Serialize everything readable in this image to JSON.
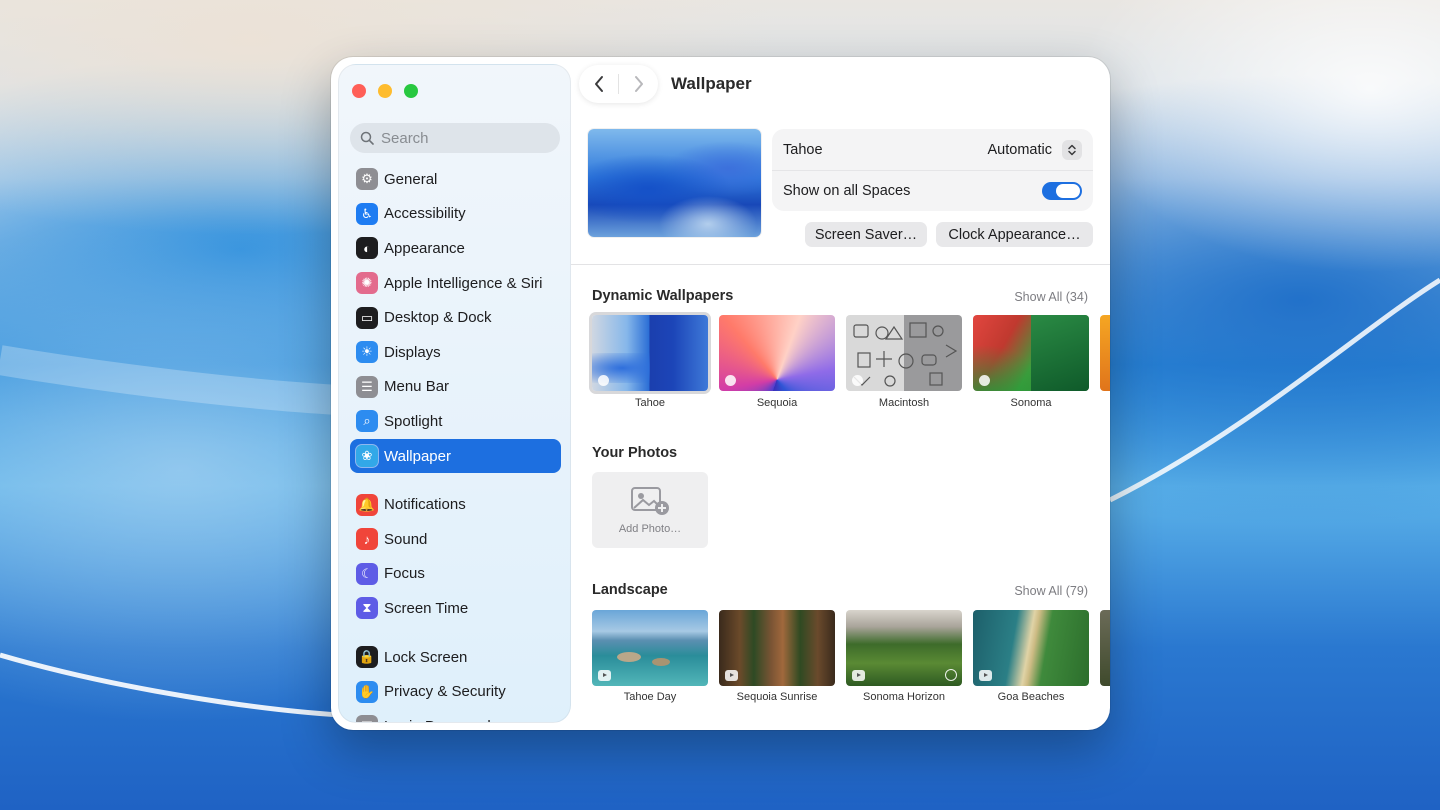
{
  "window": {
    "title": "Wallpaper",
    "search_placeholder": "Search"
  },
  "sidebar": {
    "groups": [
      [
        {
          "label": "General",
          "icon": "gear-icon",
          "color": "#8e8e93"
        },
        {
          "label": "Accessibility",
          "icon": "accessibility-icon",
          "color": "#1e7cf2"
        },
        {
          "label": "Appearance",
          "icon": "appearance-icon",
          "color": "#1d1d1f"
        },
        {
          "label": "Apple Intelligence & Siri",
          "icon": "siri-icon",
          "color": "#e36b8d"
        },
        {
          "label": "Desktop & Dock",
          "icon": "dock-icon",
          "color": "#1d1d1f"
        },
        {
          "label": "Displays",
          "icon": "sun-icon",
          "color": "#2d8cf0"
        },
        {
          "label": "Menu Bar",
          "icon": "menubar-icon",
          "color": "#8e8e93"
        },
        {
          "label": "Spotlight",
          "icon": "magnifier-icon",
          "color": "#2d8cf0"
        },
        {
          "label": "Wallpaper",
          "icon": "wallpaper-icon",
          "color": "#32a8e8",
          "active": true
        }
      ],
      [
        {
          "label": "Notifications",
          "icon": "bell-icon",
          "color": "#f0453a"
        },
        {
          "label": "Sound",
          "icon": "speaker-icon",
          "color": "#f0453a"
        },
        {
          "label": "Focus",
          "icon": "moon-icon",
          "color": "#5e5ce6"
        },
        {
          "label": "Screen Time",
          "icon": "hourglass-icon",
          "color": "#5e5ce6"
        }
      ],
      [
        {
          "label": "Lock Screen",
          "icon": "lock-icon",
          "color": "#1d1d1f"
        },
        {
          "label": "Privacy & Security",
          "icon": "hand-icon",
          "color": "#2d8cf0"
        },
        {
          "label": "Login Password",
          "icon": "key-icon",
          "color": "#8e8e93"
        }
      ]
    ]
  },
  "settings": {
    "wallpaper_name": "Tahoe",
    "mode_value": "Automatic",
    "show_all_spaces_label": "Show on all Spaces",
    "show_all_spaces_on": true,
    "screen_saver_button": "Screen Saver…",
    "clock_button": "Clock Appearance…"
  },
  "dynamic": {
    "title": "Dynamic Wallpapers",
    "show_all": "Show All (34)",
    "items": [
      "Tahoe",
      "Sequoia",
      "Macintosh",
      "Sonoma"
    ]
  },
  "photos": {
    "title": "Your Photos",
    "add_label": "Add Photo…"
  },
  "landscape": {
    "title": "Landscape",
    "show_all": "Show All (79)",
    "items": [
      "Tahoe Day",
      "Sequoia Sunrise",
      "Sonoma Horizon",
      "Goa Beaches"
    ]
  },
  "colors": {
    "accent": "#1d6fe0",
    "close": "#ff5f57",
    "minimize": "#febc2e",
    "maximize": "#28c840"
  }
}
